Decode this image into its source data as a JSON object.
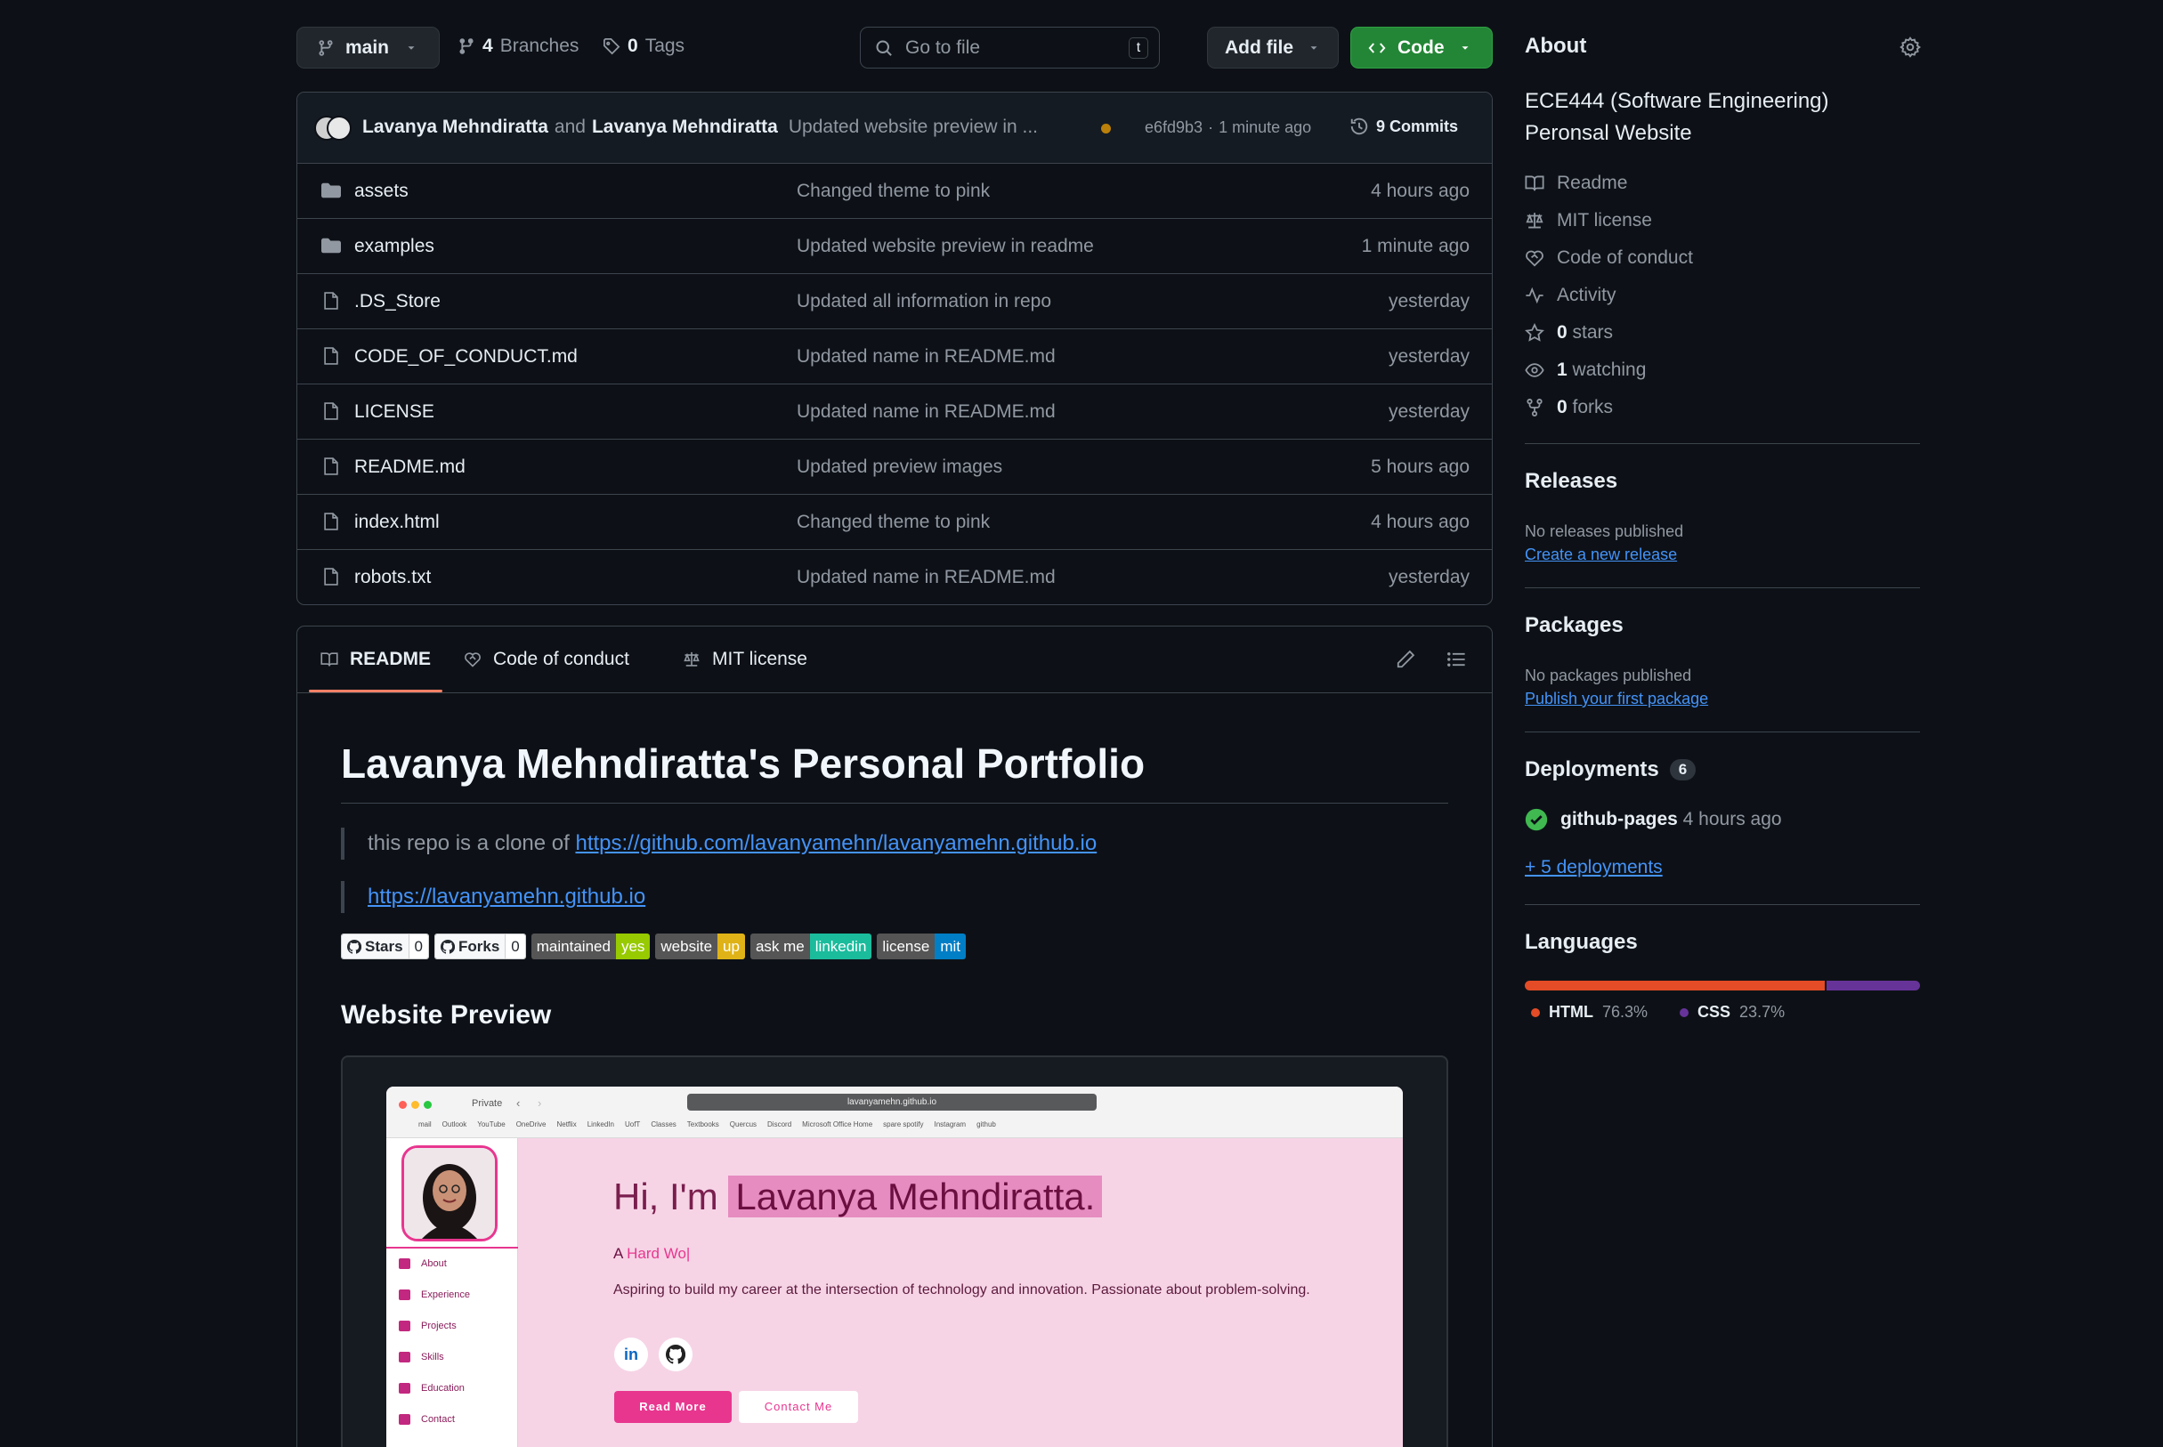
{
  "toolbar": {
    "branch": "main",
    "branches_count": "4",
    "branches_label": "Branches",
    "tags_count": "0",
    "tags_label": "Tags",
    "search_placeholder": "Go to file",
    "search_shortcut": "t",
    "add_file": "Add file",
    "code": "Code"
  },
  "commit": {
    "author1": "Lavanya Mehndiratta",
    "and": "and",
    "author2": "Lavanya Mehndiratta",
    "message": "Updated website preview in ...",
    "hash": "e6fd9b3",
    "sep": "·",
    "time": "1 minute ago",
    "commits_count": "9 Commits"
  },
  "files": [
    {
      "name": "assets",
      "type": "folder",
      "message": "Changed theme to pink",
      "time": "4 hours ago"
    },
    {
      "name": "examples",
      "type": "folder",
      "message": "Updated website preview in readme",
      "time": "1 minute ago"
    },
    {
      "name": ".DS_Store",
      "type": "file",
      "message": "Updated all information in repo",
      "time": "yesterday"
    },
    {
      "name": "CODE_OF_CONDUCT.md",
      "type": "file",
      "message": "Updated name in README.md",
      "time": "yesterday"
    },
    {
      "name": "LICENSE",
      "type": "file",
      "message": "Updated name in README.md",
      "time": "yesterday"
    },
    {
      "name": "README.md",
      "type": "file",
      "message": "Updated preview images",
      "time": "5 hours ago"
    },
    {
      "name": "index.html",
      "type": "file",
      "message": "Changed theme to pink",
      "time": "4 hours ago"
    },
    {
      "name": "robots.txt",
      "type": "file",
      "message": "Updated name in README.md",
      "time": "yesterday"
    }
  ],
  "readme_tabs": {
    "readme": "README",
    "conduct": "Code of conduct",
    "license": "MIT license"
  },
  "readme": {
    "title": "Lavanya Mehndiratta's Personal Portfolio",
    "quote1_text": "this repo is a clone of",
    "quote1_link": "https://github.com/lavanyamehn/lavanyamehn.github.io",
    "quote2_link": "https://lavanyamehn.github.io",
    "badges": {
      "stars_label": "Stars",
      "stars_count": "0",
      "forks_label": "Forks",
      "forks_count": "0",
      "maintained_l": "maintained",
      "maintained_r": "yes",
      "website_l": "website",
      "website_r": "up",
      "askme_l": "ask me",
      "askme_r": "linkedin",
      "license_l": "license",
      "license_r": "mit"
    },
    "preview_heading": "Website Preview"
  },
  "preview": {
    "tab": "Private",
    "url": "lavanyamehn.github.io",
    "bookmarks": [
      "mail",
      "Outlook",
      "YouTube",
      "OneDrive",
      "Netflix",
      "LinkedIn",
      "UofT",
      "Classes",
      "Textbooks",
      "Quercus",
      "Discord",
      "Microsoft Office Home",
      "spare spotify",
      "Instagram",
      "github"
    ],
    "nav": [
      "About",
      "Experience",
      "Projects",
      "Skills",
      "Education",
      "Contact"
    ],
    "hi": "Hi, I'm",
    "name": "Lavanya Mehndiratta.",
    "typed_prefix": "A",
    "typed": "Hard Wo|",
    "desc": "Aspiring to build my career at the intersection of technology and innovation. Passionate about problem-solving.",
    "read_more": "Read More",
    "contact_me": "Contact Me",
    "linkedin_glyph": "in"
  },
  "about": {
    "title": "About",
    "description": "ECE444 (Software Engineering) Peronsal Website",
    "readme": "Readme",
    "license": "MIT license",
    "conduct": "Code of conduct",
    "activity": "Activity",
    "stars_count": "0",
    "stars_label": "stars",
    "watching_count": "1",
    "watching_label": "watching",
    "forks_count": "0",
    "forks_label": "forks"
  },
  "releases": {
    "title": "Releases",
    "none": "No releases published",
    "create": "Create a new release"
  },
  "packages": {
    "title": "Packages",
    "none": "No packages published",
    "publish": "Publish your first package"
  },
  "deployments": {
    "title": "Deployments",
    "count": "6",
    "env": "github-pages",
    "time": "4 hours ago",
    "more": "+ 5 deployments"
  },
  "languages": {
    "title": "Languages",
    "items": [
      {
        "name": "HTML",
        "percent": "76.3%",
        "value": 76.3,
        "color": "#e34c26"
      },
      {
        "name": "CSS",
        "percent": "23.7%",
        "value": 23.7,
        "color": "#663399"
      }
    ]
  },
  "colors": {
    "accent_green": "#238636",
    "link": "#4493f8",
    "pink": "#e8368f"
  }
}
